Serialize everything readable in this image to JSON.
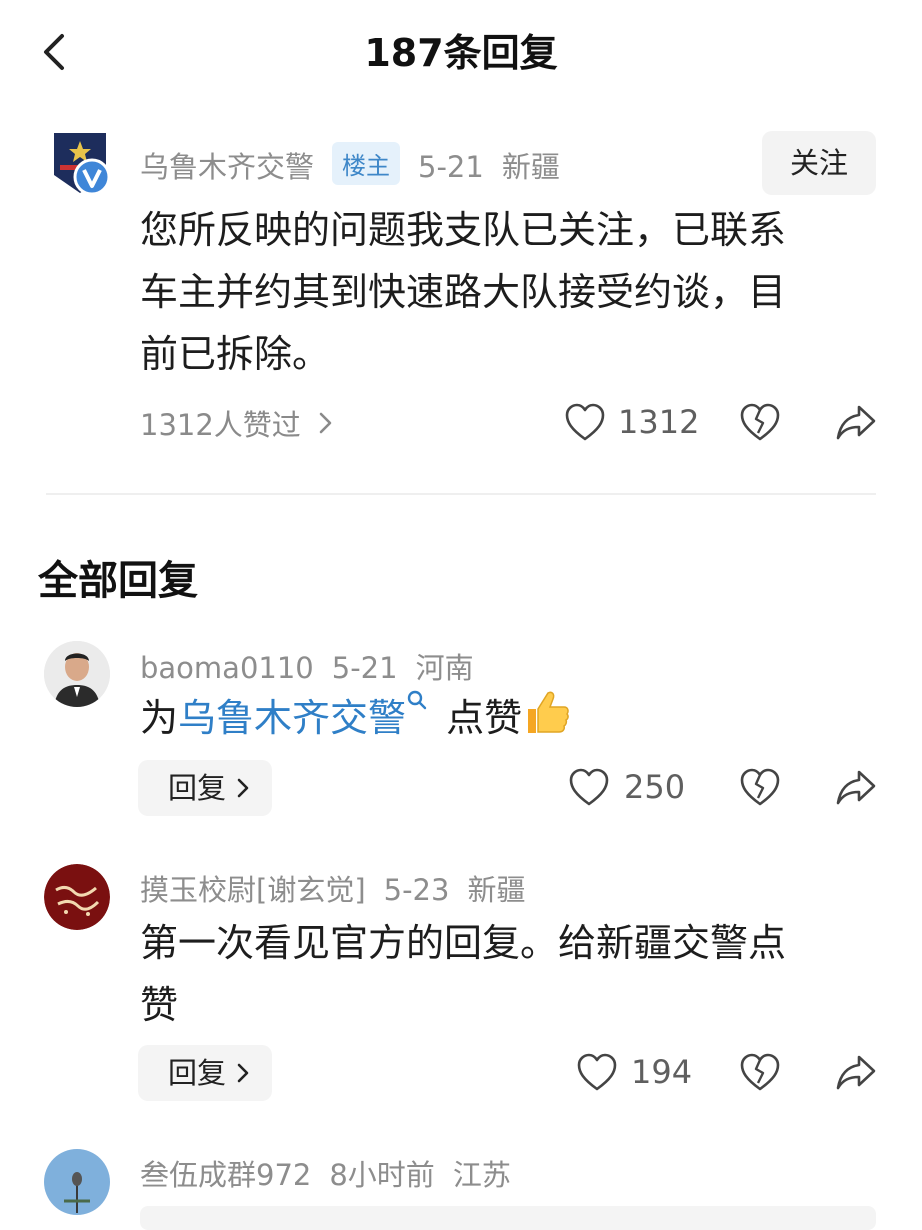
{
  "header": {
    "title": "187条回复"
  },
  "main_post": {
    "author": "乌鲁木齐交警",
    "owner_badge": "楼主",
    "date": "5-21",
    "location": "新疆",
    "follow_label": "关注",
    "text_lines": [
      "您所反映的问题我支队已关注，已联系",
      "车主并约其到快速路大队接受约谈，目",
      "前已拆除。"
    ],
    "likers_text": "1312人赞过",
    "like_count": "1312"
  },
  "section": {
    "title": "全部回复"
  },
  "replies": [
    {
      "author": "baoma0110",
      "date": "5-21",
      "location": "河南",
      "text_pre": "为",
      "mention": "乌鲁木齐交警",
      "text_post": "点赞",
      "reply_label": "回复",
      "like_count": "250"
    },
    {
      "author": "摸玉校尉[谢玄觉]",
      "date": "5-23",
      "location": "新疆",
      "text_lines": [
        "第一次看见官方的回复。给新疆交警点",
        "赞"
      ],
      "reply_label": "回复",
      "like_count": "194"
    },
    {
      "author": "叁伍成群972",
      "date": "8小时前",
      "location": "江苏"
    }
  ],
  "icons": {
    "back": "chevron-left-icon",
    "like": "heart-outline-icon",
    "dislike": "broken-heart-icon",
    "share": "share-arrow-icon",
    "verified": "verified-v-icon",
    "search": "search-icon",
    "thumbs_up": "thumbs-up-emoji"
  },
  "colors": {
    "accent": "#2f7fc7",
    "badge_bg": "#e5f1fb",
    "meta": "#8d8d8d"
  }
}
